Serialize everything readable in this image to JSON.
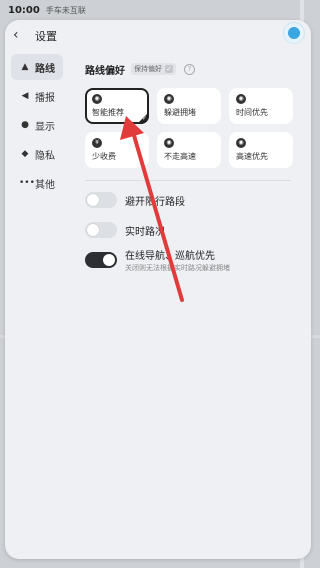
{
  "status": {
    "time": "10:00",
    "network_badge": "手车未互联"
  },
  "header": {
    "back_glyph": "‹",
    "title": "设置"
  },
  "sidebar": {
    "items": [
      {
        "label": "路线",
        "icon": "▲",
        "active": true
      },
      {
        "label": "播报",
        "icon": "◀",
        "active": false
      },
      {
        "label": "显示",
        "icon": "●",
        "active": false
      },
      {
        "label": "隐私",
        "icon": "◆",
        "active": false
      },
      {
        "label": "其他",
        "icon": "•••",
        "active": false
      }
    ]
  },
  "route_pref": {
    "title": "路线偏好",
    "keep_label": "保持偏好",
    "help_glyph": "?",
    "options": [
      {
        "label": "智能推荐",
        "icon": "◉",
        "selected": true
      },
      {
        "label": "躲避拥堵",
        "icon": "◉",
        "selected": false
      },
      {
        "label": "时间优先",
        "icon": "◉",
        "selected": false
      },
      {
        "label": "少收费",
        "icon": "¥",
        "selected": false
      },
      {
        "label": "不走高速",
        "icon": "◉",
        "selected": false
      },
      {
        "label": "高速优先",
        "icon": "◉",
        "selected": false
      }
    ]
  },
  "toggles": [
    {
      "label": "避开限行路段",
      "sub": "",
      "on": false
    },
    {
      "label": "实时路况",
      "sub": "",
      "on": false
    },
    {
      "label": "在线导航、巡航优先",
      "sub": "关闭则无法根据实时路况躲避拥堵",
      "on": true
    }
  ],
  "colors": {
    "accent": "#2d2f33",
    "annotation_arrow": "#e23b3b",
    "panel_bg": "#eef0f4"
  }
}
